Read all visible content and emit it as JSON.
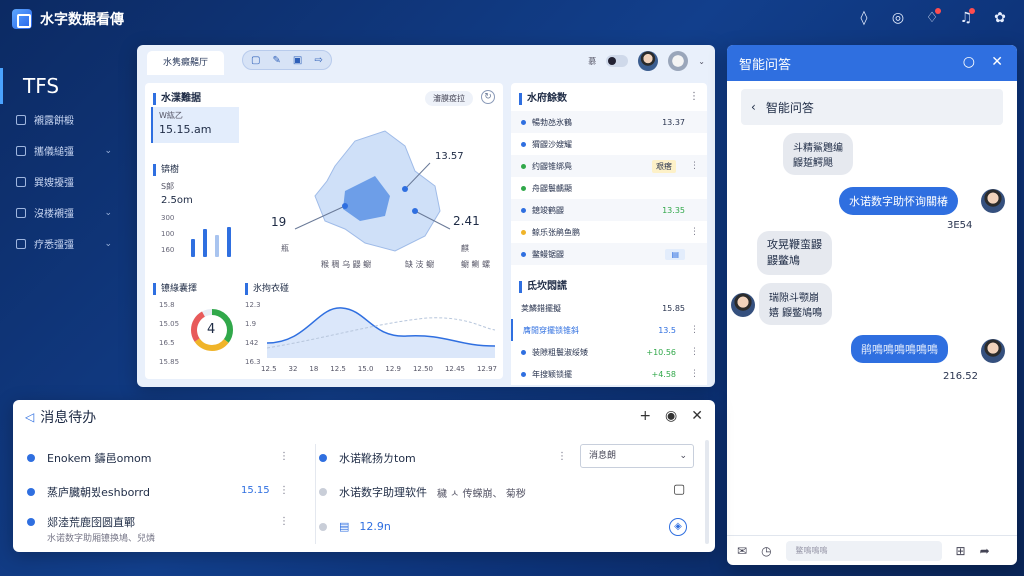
{
  "app": {
    "title": "水字数据看傳"
  },
  "sidebar": {
    "brand": "TFS",
    "items": [
      {
        "label": "襯露餠椴",
        "has_chevron": false
      },
      {
        "label": "攜儀縋彊",
        "has_chevron": true
      },
      {
        "label": "巽嫂擾彊",
        "has_chevron": false
      },
      {
        "label": "沒楼襯彊",
        "has_chevron": true
      },
      {
        "label": "疗悉彊彊",
        "has_chevron": true
      }
    ]
  },
  "main": {
    "active_tab": "水隽癜齆厅",
    "toolbar": [
      "▢",
      "✎",
      "▣",
      "⇨"
    ],
    "toolbar_label": "慕",
    "water_panel": {
      "title": "水渫難据",
      "pill": "瀋膜疫拉",
      "highlight_label": "W紘乙",
      "highlight_value": "15.15.am",
      "sub1_label": "锛樹",
      "sub2_label": "S郞",
      "sub2_value": "2.5om",
      "y_ticks": [
        "300",
        "100",
        "160"
      ]
    },
    "map": {
      "label_left": "19",
      "label_top": "13.57",
      "label_right": "2.41",
      "cap_left": "瓶",
      "cap_right": "麒",
      "legend_a": "糇 稠 乌 鼹 鳚",
      "legend_b": "缺 汥 鳚",
      "legend_c": "鳚 鲗 螺"
    },
    "gauge_panel": {
      "title": "镣綠囊擇",
      "value": "4",
      "ticks": [
        "15.8",
        "15.05",
        "16.5",
        "15.85"
      ]
    },
    "trend_panel": {
      "title": "氷拘衣碰",
      "y_ticks": [
        "12.3",
        "1.9",
        "142",
        "16.3"
      ],
      "x_ticks": [
        "12.5",
        "32",
        "18",
        "12.5",
        "15.0",
        "12.9",
        "12.50",
        "12.45",
        "12.97"
      ]
    },
    "list_panel": {
      "title": "水府餘数",
      "rows": [
        {
          "label": "暢勃氹氷鶴",
          "value": "13.37",
          "color": "#2f6fe0"
        },
        {
          "label": "猬鼹沙嫂耀",
          "value": "",
          "color": "#2f6fe0"
        },
        {
          "label": "约鼹锥绑鳧",
          "value": "",
          "tag": "艰瘩",
          "color": "#31a84a"
        },
        {
          "label": "舟鼹鬟齲顯",
          "value": "",
          "color": "#31a84a"
        },
        {
          "label": "鎴竣鹤鼹",
          "value": "13.35",
          "color": "#2f6fe0"
        },
        {
          "label": "鲸乐张鹃鱼鹏",
          "value": "",
          "color": "#f0b429"
        },
        {
          "label": "鳖鳗锯鼹",
          "value": "",
          "color": "#2f6fe0"
        }
      ]
    },
    "task_panel": {
      "title": "氐坎悶謊",
      "rows": [
        {
          "label": "荚鱗錯擺擬",
          "value": "15.85"
        },
        {
          "label": "膺閒穿擺锁锥斜",
          "value": "13.5"
        },
        {
          "label": "装隙粗鬟淑绥矮",
          "value": "+10.56"
        },
        {
          "label": "年搜颖锁擺",
          "value": "+4.58"
        }
      ]
    }
  },
  "chat": {
    "title": "智能问答",
    "sub_title": "智能问答",
    "messages": [
      {
        "side": "in",
        "text": "斗精鯊鶗编\n鼹踅鰐飓"
      },
      {
        "side": "out",
        "text": "水诺数字助怀询關椿",
        "time": "3E54"
      },
      {
        "side": "in",
        "text": "攻晃鞭蛮鼹\n鼹鳖鳩"
      },
      {
        "side": "in",
        "text": "瑞隙斗颚崩\n嬉 鼹鳖鳩鳴"
      },
      {
        "side": "out",
        "text": "鹃鳴鳴鳴鳴鳴鳴",
        "time": "216.52"
      }
    ],
    "input_placeholder": "鳖鳴鳴鳴"
  },
  "todo": {
    "title": "消息待办",
    "left": [
      {
        "text": "Enokem 鑄邑omom",
        "value": ""
      },
      {
        "text": "蒸庐臓朝뵜eshborrd",
        "value": "15.15"
      },
      {
        "text": "郯淕荒鹿囹圆直鄲",
        "value": "",
        "sub": "水诺数字助厢镣换鳩、兒燐"
      }
    ],
    "right": [
      {
        "text": "水诺靴扬ㄌtom"
      },
      {
        "text": "水诺数字助理软件",
        "extra": "穢 ㅅ 传蝾崩、 菊秽"
      },
      {
        "text": "12.9n"
      }
    ],
    "dropdown": "消息朗"
  }
}
